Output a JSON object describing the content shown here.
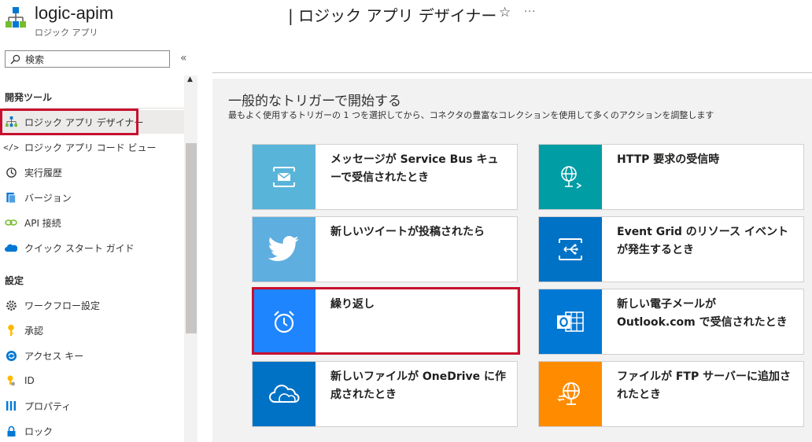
{
  "header": {
    "app_title": "logic-apim",
    "app_subtitle": "ロジック アプリ",
    "page_title": "| ロジック アプリ デザイナー",
    "star": "☆",
    "more": "···"
  },
  "search": {
    "placeholder": "検索",
    "collapse": "«"
  },
  "sidebar": {
    "sections": [
      {
        "title": "開発ツール"
      },
      {
        "title": "設定"
      }
    ],
    "items": [
      {
        "label": "ロジック アプリ デザイナー",
        "icon": "logic-app-icon",
        "active": true
      },
      {
        "label": "ロジック アプリ コード ビュー",
        "icon": "code-icon"
      },
      {
        "label": "実行履歴",
        "icon": "history-icon"
      },
      {
        "label": "バージョン",
        "icon": "versions-icon"
      },
      {
        "label": "API 接続",
        "icon": "link-icon"
      },
      {
        "label": "クイック スタート ガイド",
        "icon": "cloud-icon"
      },
      {
        "label": "ワークフロー設定",
        "icon": "gear-icon"
      },
      {
        "label": "承認",
        "icon": "key-icon"
      },
      {
        "label": "アクセス キー",
        "icon": "access-keys-icon"
      },
      {
        "label": "ID",
        "icon": "identity-icon"
      },
      {
        "label": "プロパティ",
        "icon": "properties-icon"
      },
      {
        "label": "ロック",
        "icon": "lock-icon"
      }
    ]
  },
  "designer": {
    "title": "一般的なトリガーで開始する",
    "subtitle": "最もよく使用するトリガーの 1 つを選択してから、コネクタの豊富なコレクションを使用して多くのアクションを調整します",
    "cards": [
      {
        "label": "メッセージが Service Bus キューで受信されたとき",
        "icon": "service-bus-icon",
        "color": "#59b4d9"
      },
      {
        "label": "HTTP 要求の受信時",
        "icon": "http-globe-icon",
        "color": "#009da5"
      },
      {
        "label": "新しいツイートが投稿されたら",
        "icon": "twitter-icon",
        "color": "#5eaee0"
      },
      {
        "label": "Event Grid のリソース イベントが発生するとき",
        "icon": "event-grid-icon",
        "color": "#0072c6"
      },
      {
        "label": "繰り返し",
        "icon": "recurrence-clock-icon",
        "color": "#1f85ff"
      },
      {
        "label": "新しい電子メールが Outlook.com で受信されたとき",
        "icon": "outlook-icon",
        "color": "#0078d4"
      },
      {
        "label": "新しいファイルが OneDrive に作成されたとき",
        "icon": "onedrive-icon",
        "color": "#0072c6"
      },
      {
        "label": "ファイルが FTP サーバーに追加されたとき",
        "icon": "ftp-icon",
        "color": "#ff8c00"
      }
    ]
  }
}
